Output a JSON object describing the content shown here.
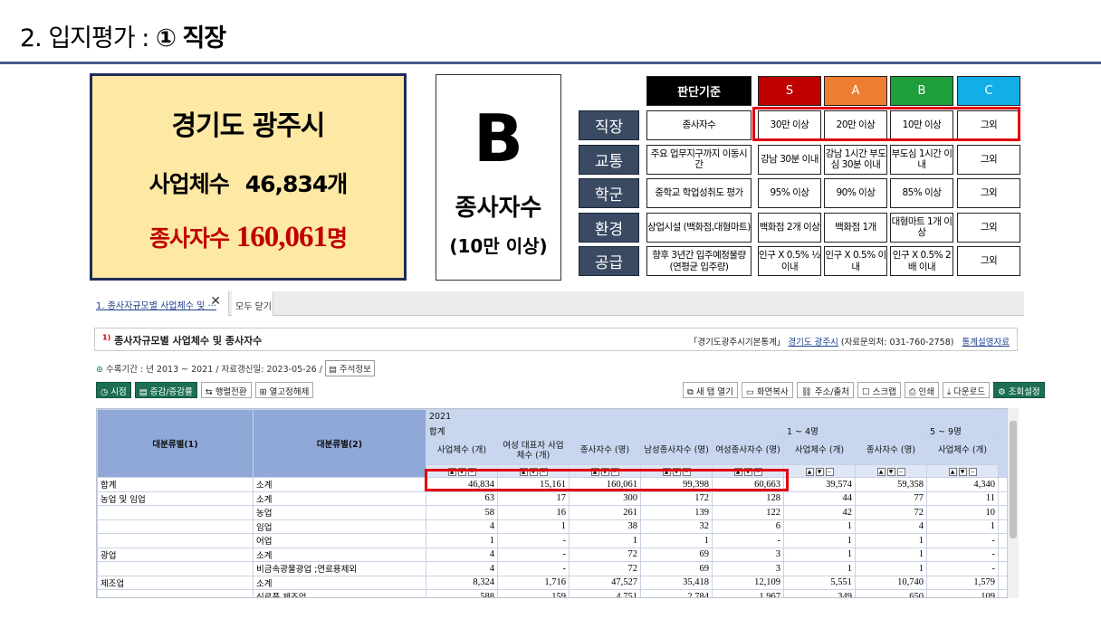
{
  "title": {
    "prefix": "2. 입지평가 : ",
    "circle": "①",
    "bold": "직장"
  },
  "summary": {
    "city": "경기도 광주시",
    "biz_label": "사업체수",
    "biz_value": "46,834개",
    "emp_label": "종사자수",
    "emp_value": "160,061",
    "emp_unit": "명"
  },
  "grade": {
    "letter": "B",
    "label1": "종사자수",
    "label2": "(10만 이상)"
  },
  "criteria": {
    "header": "판단기준",
    "grades": [
      {
        "label": "S",
        "color": "#c00000"
      },
      {
        "label": "A",
        "color": "#ed7d31"
      },
      {
        "label": "B",
        "color": "#1f9e3c"
      },
      {
        "label": "C",
        "color": "#12aee8"
      }
    ],
    "rows": [
      {
        "name": "직장",
        "basis": "종사자수",
        "values": [
          "30만 이상",
          "20만 이상",
          "10만 이상",
          "그외"
        ]
      },
      {
        "name": "교통",
        "basis": "주요 업무지구까지 이동시간",
        "values": [
          "강남 30분 이내",
          "강남 1시간 부도심 30분 이내",
          "부도심 1시간 이내",
          "그외"
        ]
      },
      {
        "name": "학군",
        "basis": "중학교 학업성취도 평가",
        "values": [
          "95% 이상",
          "90% 이상",
          "85% 이상",
          "그외"
        ]
      },
      {
        "name": "환경",
        "basis": "상업시설 (백화점,대형마트)",
        "values": [
          "백화점 2개 이상",
          "백화점 1개",
          "대형마트 1개 이상",
          "그외"
        ]
      },
      {
        "name": "공급",
        "basis": "향후 3년간 입주예정물량 (연평균 입주량)",
        "values": [
          "인구 X 0.5% ½ 이내",
          "인구 X 0.5% 이내",
          "인구 X 0.5% 2배 이내",
          "그외"
        ]
      }
    ]
  },
  "tabs": {
    "active": "1. 종사자규모별 사업체수 및 ···",
    "close": "✕",
    "close_all": "모두 닫기"
  },
  "stat": {
    "sup": "1)",
    "title": "종사자규모별 사업체수 및 종사자수",
    "src_prefix": "「경기도광주시기본통계」",
    "src_link": "경기도 광주시",
    "src_contact": "(자료문의처: 031-760-2758)",
    "guide": "통계설명자료"
  },
  "meta": {
    "text": "수록기간 : 년 2013 ~ 2021 / 자료갱신일: 2023-05-26 /",
    "note_btn": "주석정보"
  },
  "toolbar_left": [
    "시점",
    "증감/증감률",
    "행렬전환",
    "열고정해제"
  ],
  "toolbar_right": [
    "새 탭 열기",
    "화면복사",
    "주소/출처",
    "스크랩",
    "인쇄",
    "다운로드",
    "조회설정"
  ],
  "table": {
    "year": "2021",
    "col1": "대분류별(1)",
    "col2": "대분류별(2)",
    "group1": "합계",
    "group2": "1 ~ 4명",
    "group3": "5 ~ 9명",
    "subheads": [
      "사업체수 (개)",
      "여성 대표자 사업체수 (개)",
      "종사자수 (명)",
      "남성종사자수 (명)",
      "여성종사자수 (명)",
      "사업체수 (개)",
      "종사자수 (명)",
      "사업체수 (개)"
    ],
    "rows": [
      {
        "c1": "합계",
        "c2": "소계",
        "v": [
          "46,834",
          "15,161",
          "160,061",
          "99,398",
          "60,663",
          "39,574",
          "59,358",
          "4,340"
        ]
      },
      {
        "c1": "농업 및 임업",
        "c2": "소계",
        "v": [
          "63",
          "17",
          "300",
          "172",
          "128",
          "44",
          "77",
          "11"
        ]
      },
      {
        "c1": "",
        "c2": "농업",
        "v": [
          "58",
          "16",
          "261",
          "139",
          "122",
          "42",
          "72",
          "10"
        ]
      },
      {
        "c1": "",
        "c2": "임업",
        "v": [
          "4",
          "1",
          "38",
          "32",
          "6",
          "1",
          "4",
          "1"
        ]
      },
      {
        "c1": "",
        "c2": "어업",
        "v": [
          "1",
          "-",
          "1",
          "1",
          "-",
          "1",
          "1",
          "-"
        ]
      },
      {
        "c1": "광업",
        "c2": "소계",
        "v": [
          "4",
          "-",
          "72",
          "69",
          "3",
          "1",
          "1",
          "-"
        ]
      },
      {
        "c1": "",
        "c2": "비금속광물광업 ;연료용제외",
        "v": [
          "4",
          "-",
          "72",
          "69",
          "3",
          "1",
          "1",
          "-"
        ]
      },
      {
        "c1": "제조업",
        "c2": "소계",
        "v": [
          "8,324",
          "1,716",
          "47,527",
          "35,418",
          "12,109",
          "5,551",
          "10,740",
          "1,579"
        ]
      },
      {
        "c1": "",
        "c2": "식료품 제조업",
        "v": [
          "588",
          "159",
          "4,751",
          "2,784",
          "1,967",
          "349",
          "650",
          "109"
        ]
      }
    ]
  }
}
